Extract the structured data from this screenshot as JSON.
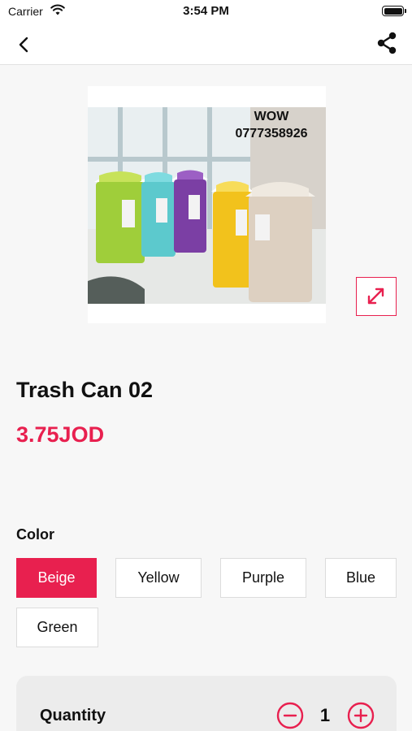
{
  "status_bar": {
    "carrier": "Carrier",
    "time": "3:54 PM"
  },
  "nav": {
    "back_icon": "chevron-left-icon",
    "share_icon": "share-icon"
  },
  "product": {
    "image_text_line1": "WOW",
    "image_text_line2": "0777358926",
    "title": "Trash Can 02",
    "price": "3.75JOD",
    "expand_icon": "expand-icon"
  },
  "colors": {
    "label": "Color",
    "options": [
      "Beige",
      "Yellow",
      "Purple",
      "Blue",
      "Green"
    ],
    "selected": "Beige"
  },
  "quantity": {
    "label": "Quantity",
    "value": "1"
  },
  "theme": {
    "accent": "#e8204f",
    "background": "#f7f7f7"
  }
}
